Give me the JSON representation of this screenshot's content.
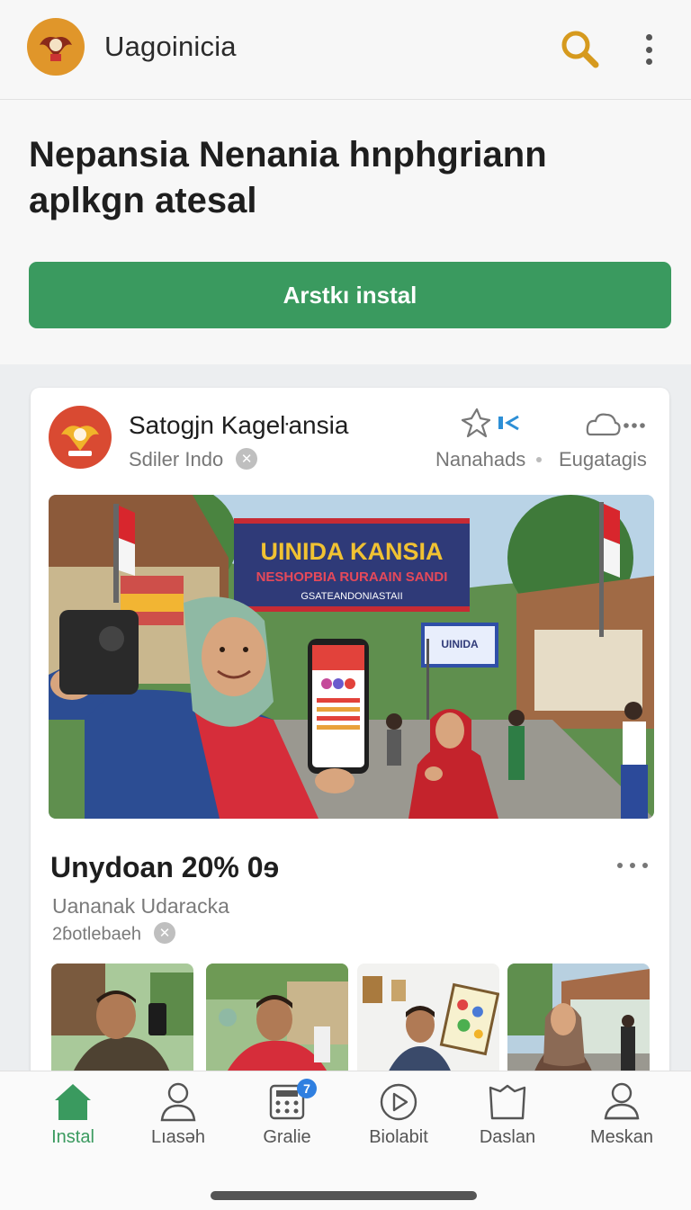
{
  "app": {
    "title": "Uagoinicia",
    "colors": {
      "accent": "#3a9a5f",
      "logo": "#e0962a",
      "badge": "#2f7fe0"
    }
  },
  "header_icons": [
    "search-icon",
    "more-vertical-icon"
  ],
  "hero": {
    "title": "Nepansia Nenania hnphgriann aplkgn atesal",
    "install_label": "Arstkı instal"
  },
  "post": {
    "author": "Satogjn Kageŀansia",
    "subtitle": "Sdiler Indo",
    "actions": [
      {
        "icon": "share-sparkle-icon",
        "label": "Nanahads"
      },
      {
        "icon": "cloud-more-icon",
        "label": "Eugatagis"
      }
    ],
    "photo": {
      "banner_line1": "UINIDA KANSIA",
      "banner_line2": "NESHOPBIA RURAAIN SANDI",
      "banner_line3": "GSATEANDONIASTAII",
      "small_banner": "UINIDA"
    },
    "promo_title": "Unydoan 20% 0ɘ",
    "promo_subtitle": "Uananak Udaracka",
    "promo_meta": "2ɓotlebaeh"
  },
  "nav": {
    "items": [
      {
        "label": "Instal",
        "icon": "home-icon",
        "active": true
      },
      {
        "label": "Lıasəh",
        "icon": "user-icon"
      },
      {
        "label": "Gralie",
        "icon": "grid-calculator-icon",
        "badge": "7"
      },
      {
        "label": "Biolabit",
        "icon": "play-circle-icon"
      },
      {
        "label": "Daslan",
        "icon": "folder-icon"
      },
      {
        "label": "Meskan",
        "icon": "account-icon"
      }
    ]
  }
}
